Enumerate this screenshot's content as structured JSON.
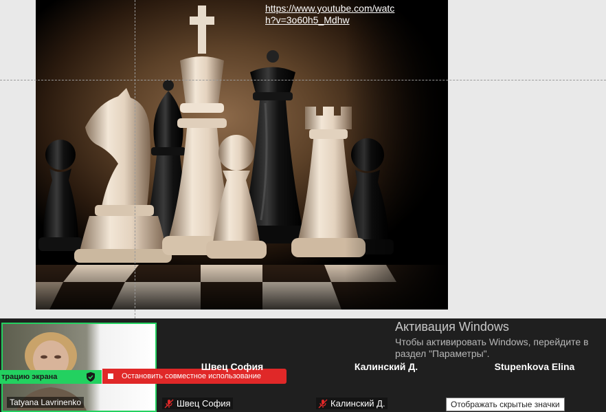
{
  "slide": {
    "link_text": "https://www.youtube.com/watch?v=3o60h5_Mdhw"
  },
  "self_view": {
    "name": "Tatyana Lavrinenko",
    "share_badge": "трацию экрана"
  },
  "stop_share": {
    "label": "Остановить совместное использование"
  },
  "participants": [
    {
      "title": "Швец София",
      "name": "Швец София",
      "muted": true
    },
    {
      "title": "Калинский Д.",
      "name": "Калинский Д.",
      "muted": true
    },
    {
      "title": "Stupenkova Elina",
      "name": "",
      "muted": false
    }
  ],
  "windows_activation": {
    "title": "Активация Windows",
    "text": "Чтобы активировать Windows, перейдите в раздел \"Параметры\"."
  },
  "tooltip": {
    "text": "Отображать скрытые значки"
  },
  "colors": {
    "active_speaker_border": "#23d160",
    "stop_share_bg": "#e02828",
    "zoom_bar_bg": "#1f1f1f",
    "muted_icon": "#e02828"
  }
}
